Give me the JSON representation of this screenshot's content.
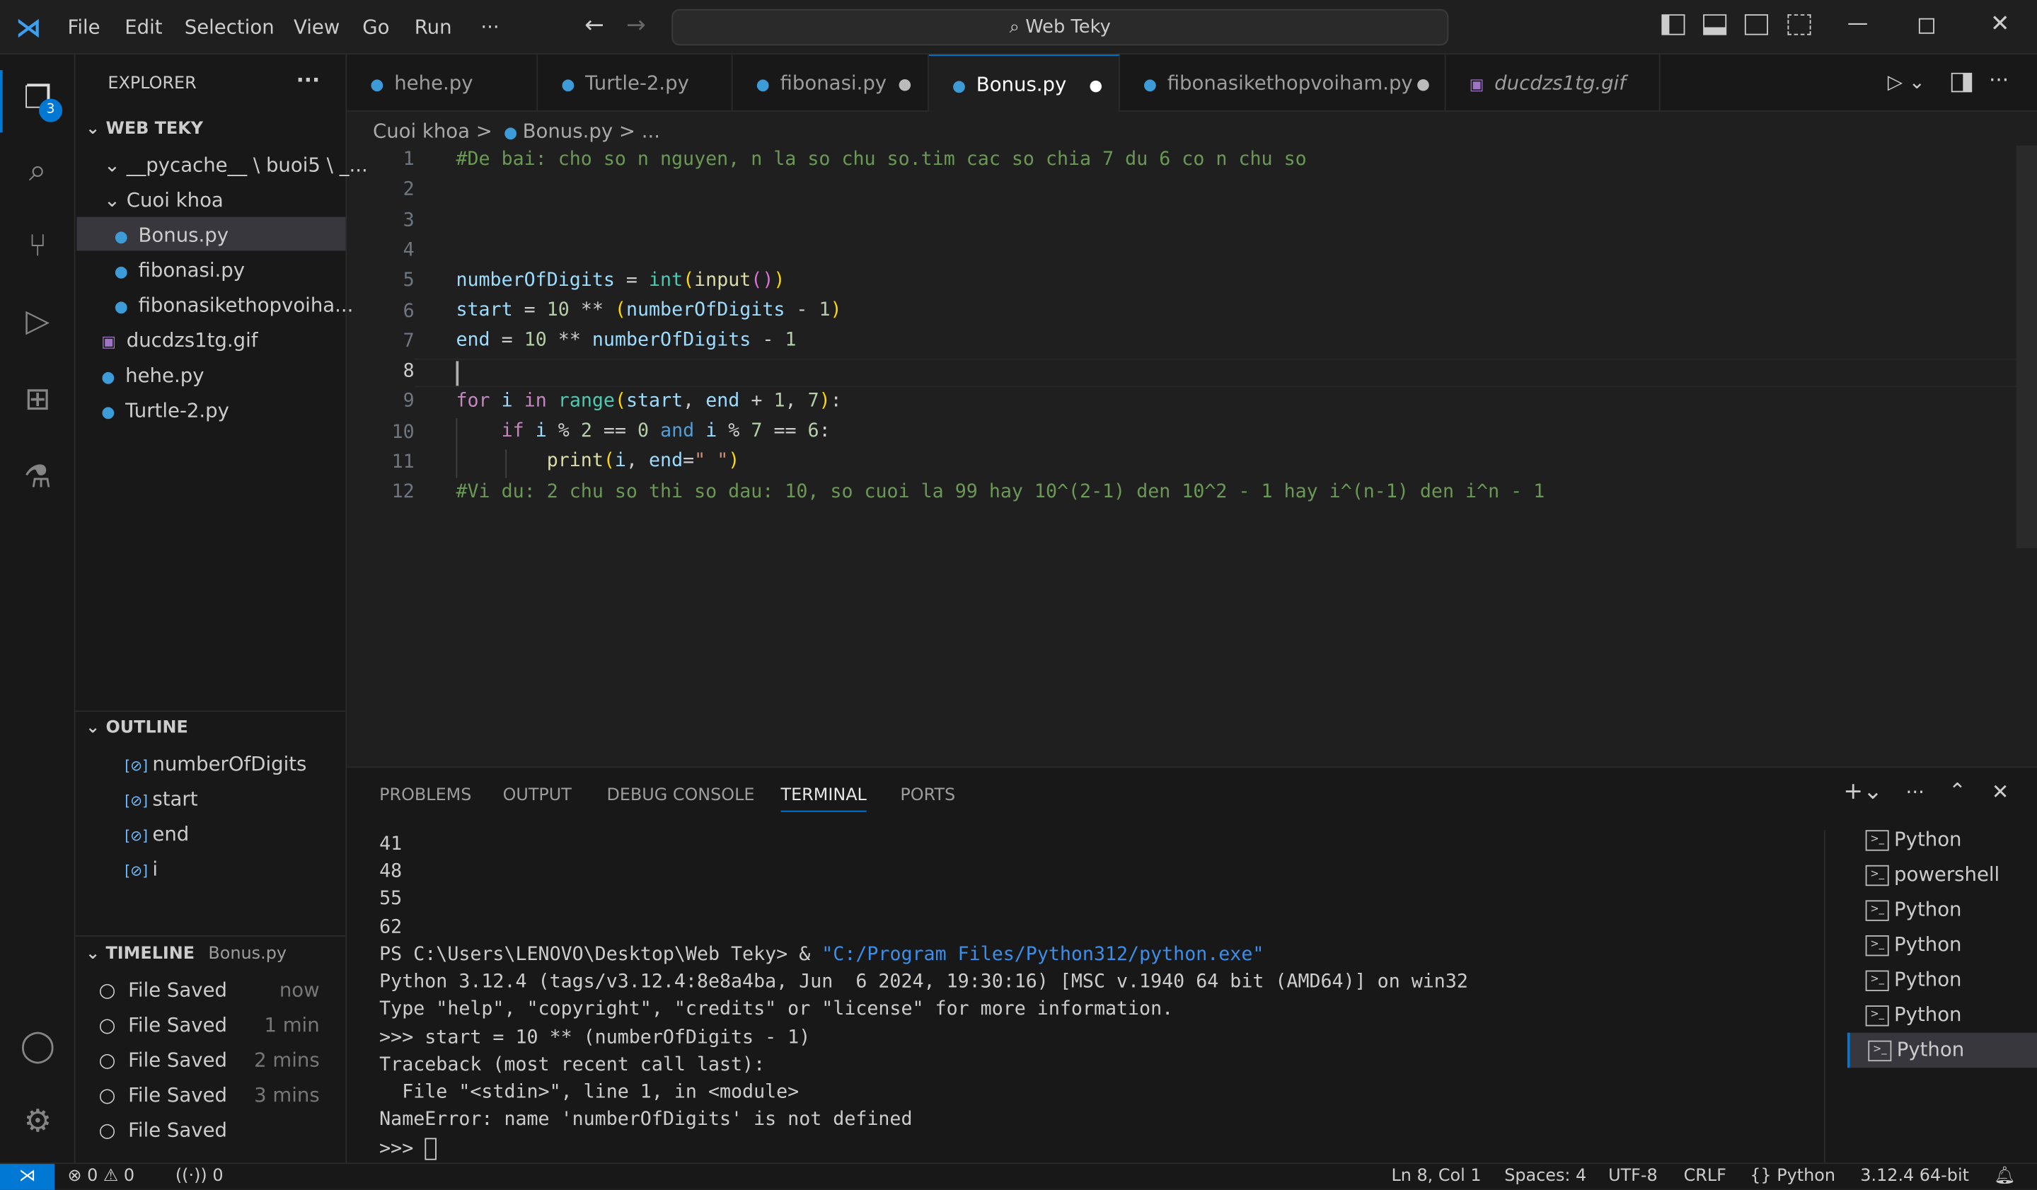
{
  "titlebar": {
    "menu": [
      "File",
      "Edit",
      "Selection",
      "View",
      "Go",
      "Run",
      "···"
    ],
    "search": "Web Teky"
  },
  "activity": {
    "badge": "3"
  },
  "explorer": {
    "title": "EXPLORER",
    "more": "···",
    "workspace": "WEB TEKY",
    "items": [
      {
        "label": "__pycache__ \\ buoi5 \\ _..."
      },
      {
        "label": "Cuoi khoa"
      },
      {
        "label": "Bonus.py"
      },
      {
        "label": "fibonasi.py"
      },
      {
        "label": "fibonasikethopvoiha..."
      },
      {
        "label": "ducdzs1tg.gif"
      },
      {
        "label": "hehe.py"
      },
      {
        "label": "Turtle-2.py"
      }
    ]
  },
  "outline": {
    "title": "OUTLINE",
    "items": [
      "numberOfDigits",
      "start",
      "end",
      "i"
    ]
  },
  "timeline": {
    "title": "TIMELINE",
    "file": "Bonus.py",
    "items": [
      {
        "label": "File Saved",
        "time": "now"
      },
      {
        "label": "File Saved",
        "time": "1 min"
      },
      {
        "label": "File Saved",
        "time": "2 mins"
      },
      {
        "label": "File Saved",
        "time": "3 mins"
      },
      {
        "label": "File Saved",
        "time": ""
      }
    ]
  },
  "tabs": [
    {
      "label": "hehe.py"
    },
    {
      "label": "Turtle-2.py"
    },
    {
      "label": "fibonasi.py"
    },
    {
      "label": "Bonus.py"
    },
    {
      "label": "fibonasikethopvoiham.py"
    },
    {
      "label": "ducdzs1tg.gif"
    }
  ],
  "breadcrumb": {
    "folder": "Cuoi khoa",
    "file": "Bonus.py",
    "more": "..."
  },
  "code": {
    "line_numbers": [
      "1",
      "2",
      "3",
      "4",
      "5",
      "6",
      "7",
      "8",
      "9",
      "10",
      "11",
      "12"
    ],
    "l1": "#De bai: cho so n nguyen, n la so chu so.tim cac so chia 7 du 6 co n chu so",
    "l12": "#Vi du: 2 chu so thi so dau: 10, so cuoi la 99 hay 10^(2-1) den 10^2 - 1 hay i^(n-1) den i^n - 1"
  },
  "panel": {
    "tabs": [
      "PROBLEMS",
      "OUTPUT",
      "DEBUG CONSOLE",
      "TERMINAL",
      "PORTS"
    ],
    "terminal_lines": [
      "41",
      "48",
      "55",
      "62"
    ],
    "prompt": "PS C:\\Users\\LENOVO\\Desktop\\Web Teky> & ",
    "exe": "\"C:/Program Files/Python312/python.exe\"",
    "lines2": [
      "Python 3.12.4 (tags/v3.12.4:8e8a4ba, Jun  6 2024, 19:30:16) [MSC v.1940 64 bit (AMD64)] on win32",
      "Type \"help\", \"copyright\", \"credits\" or \"license\" for more information.",
      ">>> start = 10 ** (numberOfDigits - 1)",
      "Traceback (most recent call last):",
      "  File \"<stdin>\", line 1, in <module>",
      "NameError: name 'numberOfDigits' is not defined",
      ">>> "
    ],
    "terminals": [
      "Python",
      "powershell",
      "Python",
      "Python",
      "Python",
      "Python",
      "Python"
    ]
  },
  "status": {
    "errors": "0",
    "warnings": "0",
    "ports": "0",
    "position": "Ln 8, Col 1",
    "spaces": "Spaces: 4",
    "encoding": "UTF-8",
    "eol": "CRLF",
    "language": "Python",
    "interpreter": "3.12.4 64-bit"
  }
}
